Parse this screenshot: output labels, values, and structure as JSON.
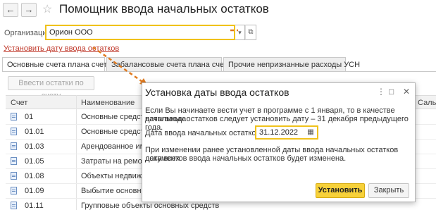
{
  "header": {
    "back_icon": "←",
    "forward_icon": "→",
    "favorite_icon": "☆",
    "title": "Помощник ввода начальных остатков"
  },
  "organization": {
    "label": "Организация:",
    "value": "Орион ООО",
    "dropdown_icon": "▾",
    "open_icon": "⧉"
  },
  "set_date_link": "Установить дату ввода остатков",
  "tabs": [
    {
      "label": "Основные счета плана счетов",
      "active": true
    },
    {
      "label": "Забалансовые счета плана счетов",
      "active": false
    },
    {
      "label": "Прочие непризнанные расходы УСН",
      "active": false
    }
  ],
  "enter_balances_button": "Ввести остатки по счету",
  "table": {
    "columns": [
      "Счет",
      "Наименование",
      "Сальд"
    ],
    "rows": [
      {
        "code": "01",
        "name": "Основные средства"
      },
      {
        "code": "01.01",
        "name": "Основные средства"
      },
      {
        "code": "01.03",
        "name": "Арендованное иму"
      },
      {
        "code": "01.05",
        "name": "Затраты на ремонт с"
      },
      {
        "code": "01.08",
        "name": "Объекты недвижим"
      },
      {
        "code": "01.09",
        "name": "Выбытие основных"
      },
      {
        "code": "01.11",
        "name": "Групповые объекты основных средств"
      }
    ]
  },
  "dialog": {
    "title": "Установка даты ввода остатков",
    "more_icon": "⋮",
    "maximize_icon": "□",
    "close_icon": "✕",
    "intro_line1": "Если Вы начинаете вести учет в программе с 1 января, то в качестве даты ввода",
    "intro_line2": "начальных остатков следует установить дату – 31 декабря предыдущего года.",
    "date_label": "Дата ввода начальных остатков:",
    "date_value": "31.12.2022",
    "calendar_icon": "▦",
    "note_line1": "При изменении ранее установленной даты ввода начальных остатков дата всех",
    "note_line2": "документов ввода начальных остатков будет изменена.",
    "set_button": "Установить",
    "close_button": "Закрыть"
  },
  "colors": {
    "accent_yellow": "#f0c21b",
    "link_red": "#c0392b",
    "arrow_orange": "#e07a1f"
  }
}
